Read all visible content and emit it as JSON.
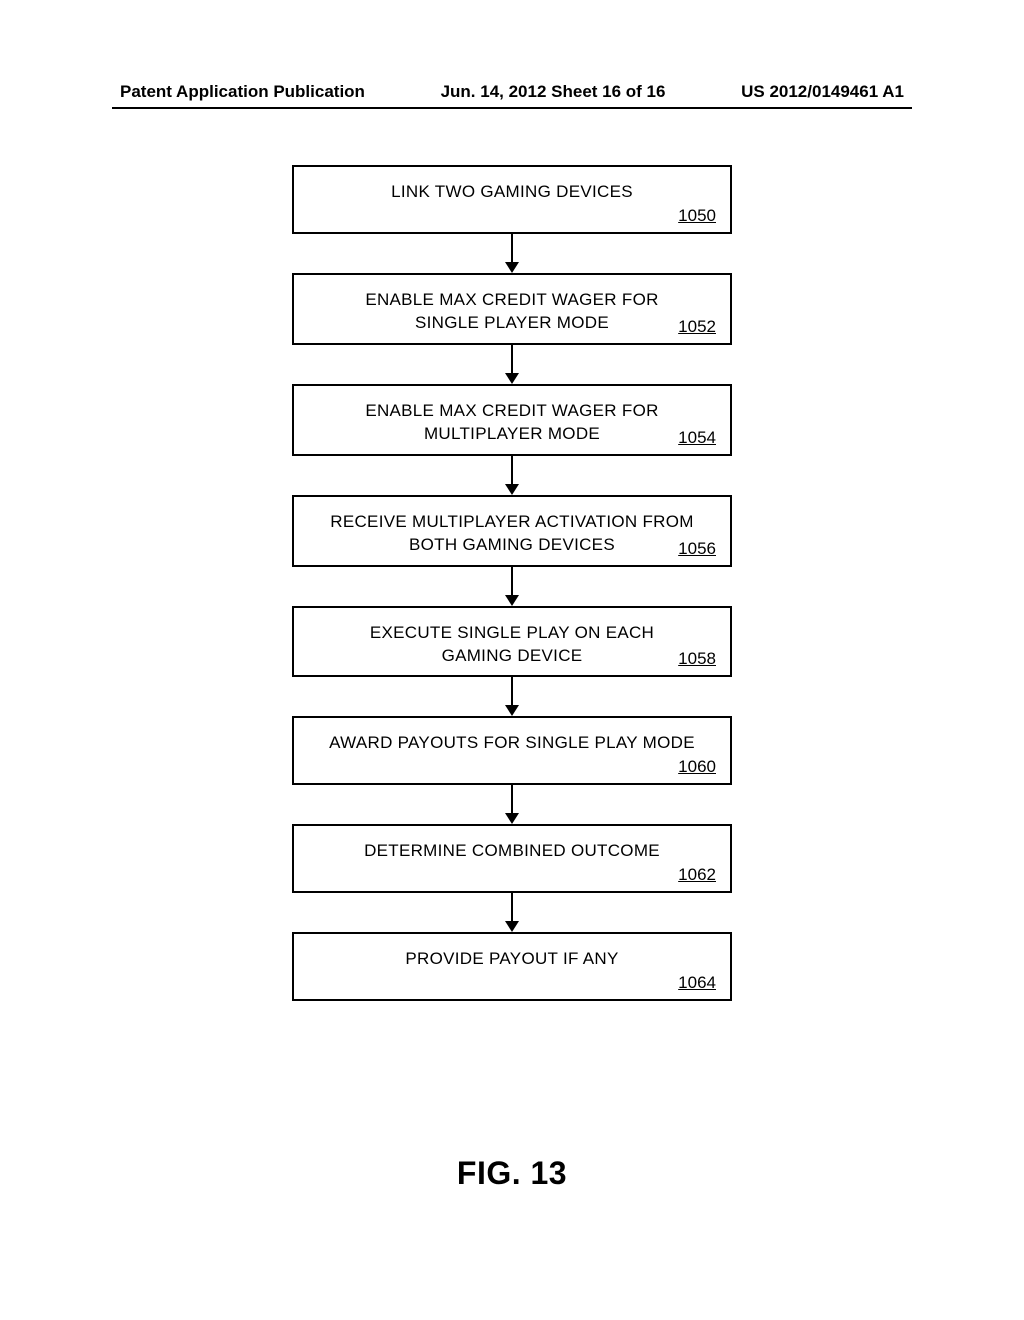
{
  "header": {
    "left": "Patent Application Publication",
    "center": "Jun. 14, 2012  Sheet 16 of 16",
    "right": "US 2012/0149461 A1"
  },
  "steps": [
    {
      "text": "LINK TWO GAMING DEVICES",
      "ref": "1050"
    },
    {
      "text": "ENABLE MAX CREDIT WAGER FOR\nSINGLE PLAYER MODE",
      "ref": "1052"
    },
    {
      "text": "ENABLE MAX CREDIT WAGER FOR\nMULTIPLAYER MODE",
      "ref": "1054"
    },
    {
      "text": "RECEIVE MULTIPLAYER ACTIVATION FROM\nBOTH GAMING DEVICES",
      "ref": "1056"
    },
    {
      "text": "EXECUTE SINGLE PLAY ON EACH\nGAMING DEVICE",
      "ref": "1058"
    },
    {
      "text": "AWARD PAYOUTS FOR SINGLE PLAY MODE",
      "ref": "1060"
    },
    {
      "text": "DETERMINE COMBINED OUTCOME",
      "ref": "1062"
    },
    {
      "text": "PROVIDE PAYOUT IF ANY",
      "ref": "1064"
    }
  ],
  "figure_label": "FIG. 13"
}
